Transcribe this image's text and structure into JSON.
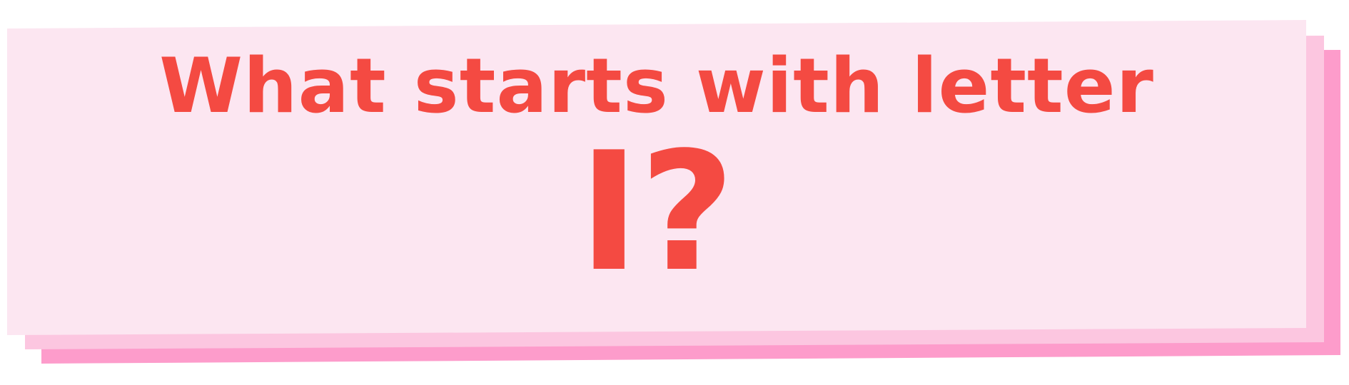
{
  "banner": {
    "line1": "What starts with letter",
    "line2": "I?"
  },
  "colors": {
    "text": "#f44a42",
    "panel_front": "#fce6f1",
    "panel_middle": "#fcc6e0",
    "panel_back": "#fd9ccb",
    "background": "#ffffff"
  }
}
